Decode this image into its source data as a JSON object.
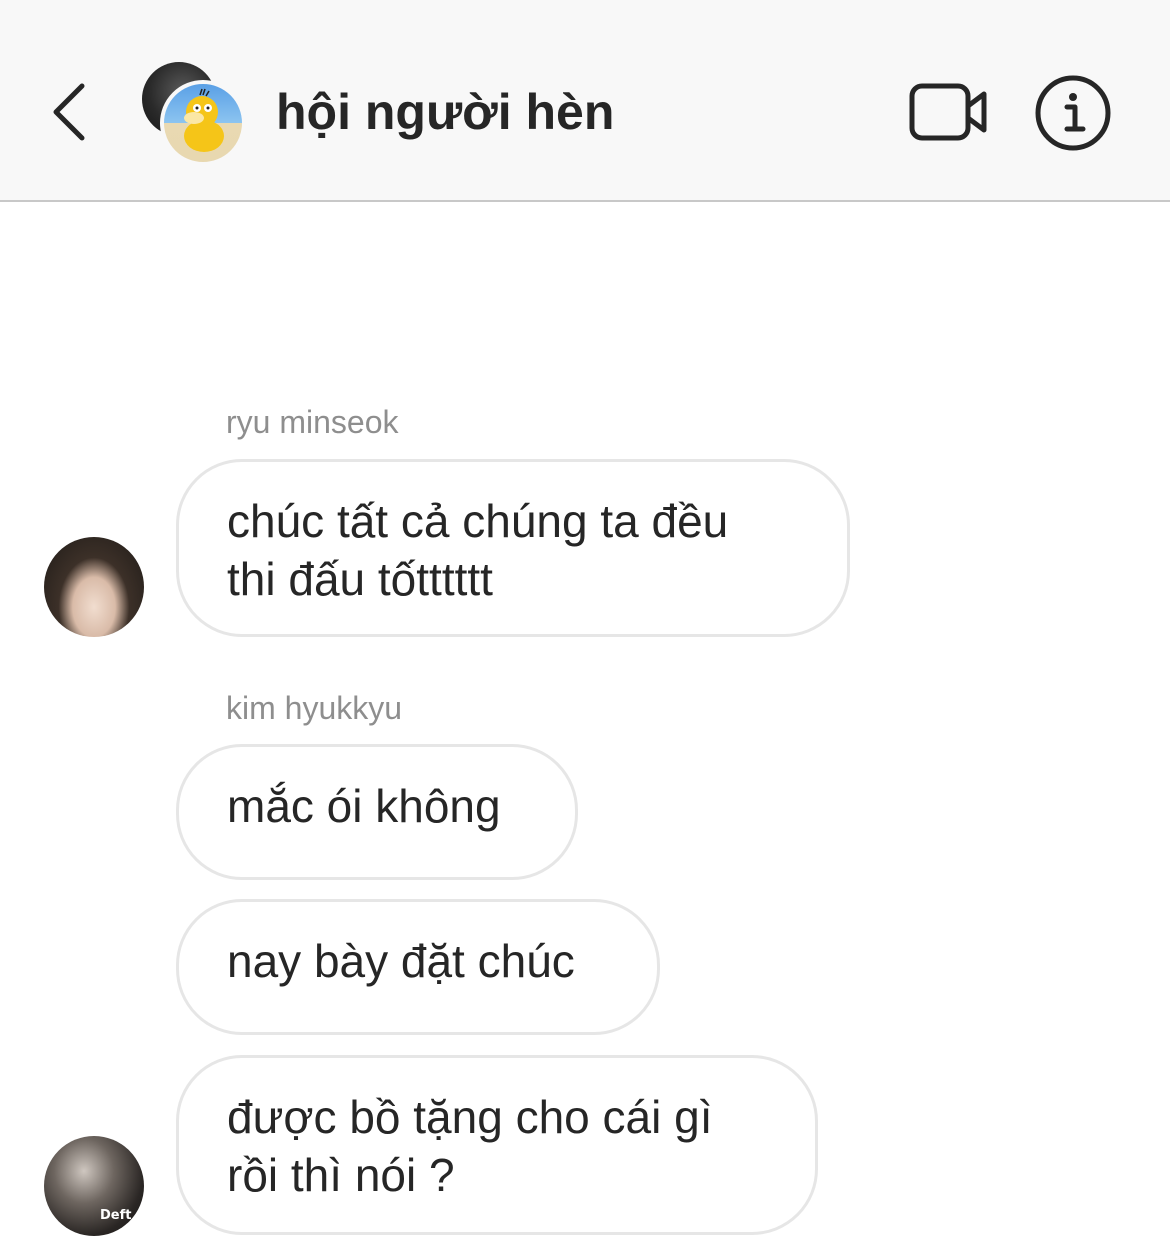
{
  "header": {
    "title": "hội người hèn",
    "back_icon": "chevron-left-icon",
    "video_icon": "video-camera-icon",
    "info_icon": "info-circle-icon",
    "background": "#f8f8f8"
  },
  "messages": [
    {
      "sender": "ryu minseok",
      "avatar": "ryu-minseok-avatar",
      "bubbles": [
        "chúc tất cả chúng ta đều\nthi đấu tốtttttt"
      ]
    },
    {
      "sender": "kim hyukkyu",
      "avatar": "kim-hyukkyu-avatar",
      "avatar_caption": "Deft",
      "bubbles": [
        "mắc ói không",
        "nay bày đặt chúc",
        "được bồ tặng cho cái gì\nrồi thì nói ?"
      ]
    }
  ],
  "colors": {
    "text": "#262626",
    "secondary_text": "#8e8e8e",
    "bubble_border": "#e6e6e6"
  }
}
